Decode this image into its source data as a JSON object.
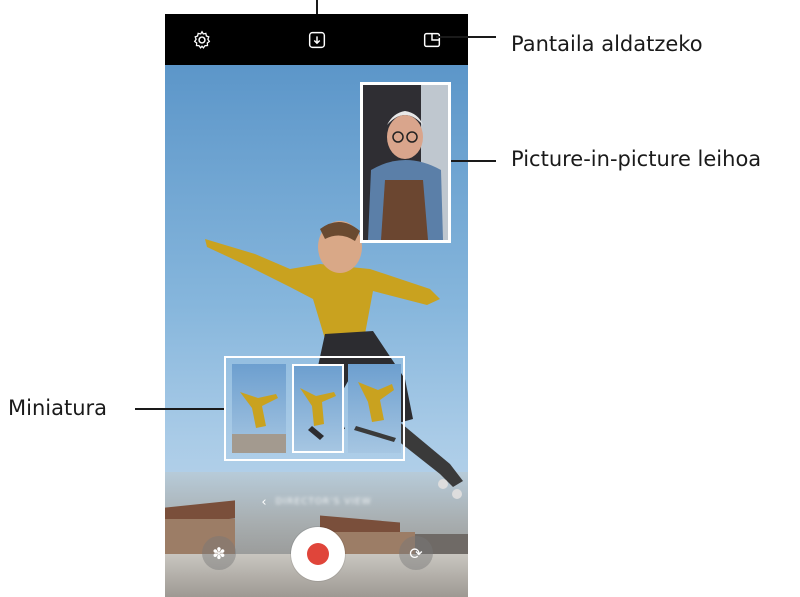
{
  "callouts": {
    "screen_switch": "Pantaila aldatzeko",
    "pip_window": "Picture-in-picture leihoa",
    "thumbnail": "Miniatura"
  },
  "icons": {
    "settings": "gear-icon",
    "download": "download-icon",
    "screen_switch": "split-screen-icon",
    "filter": "flower-icon",
    "switch_camera": "camera-switch-icon",
    "back": "chevron-left-icon"
  },
  "camera": {
    "mode_bar_label": "DIRECTOR'S VIEW",
    "record_color": "#e0453a"
  }
}
